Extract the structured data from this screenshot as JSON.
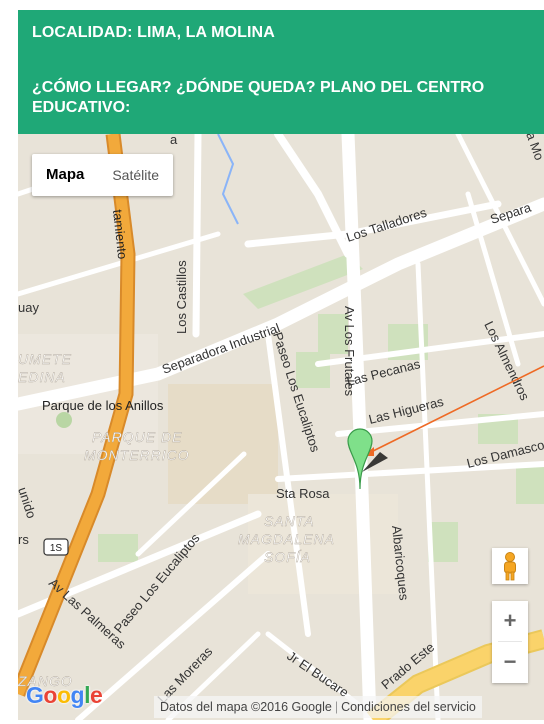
{
  "header": {
    "locality": "LOCALIDAD: LIMA, LA MOLINA",
    "directions": "¿CÓMO LLEGAR? ¿DÓNDE QUEDA? PLANO DEL CENTRO EDUCATIVO:"
  },
  "map": {
    "map_type_options": [
      "Mapa",
      "Satélite"
    ],
    "selected_map_type": "Mapa",
    "zoom_in_label": "+",
    "zoom_out_label": "−",
    "logo": {
      "letters": [
        "G",
        "o",
        "o",
        "g",
        "l",
        "e"
      ],
      "colors": [
        "#4285f4",
        "#ea4335",
        "#fbbc05",
        "#4285f4",
        "#34a853",
        "#ea4335"
      ]
    },
    "attribution": "Datos del mapa ©2016 Google",
    "terms": "Condiciones del servicio",
    "labels": {
      "tamiento": "tamiento",
      "los_talladores": "Los Talladores",
      "separa": "Separa",
      "los_castillos": "Los Castillos",
      "separadora_industrial": "Separadora Industrial",
      "av_los_frutales": "Av Los Frutales",
      "uay": "uay",
      "umete": "UMETE",
      "edina": "EDINA",
      "parque_anillos": "Parque de los Anillos",
      "parque_de": "PARQUE DE",
      "monterrico": "MONTERRICO",
      "paseo_eucaliptos_1": "Paseo Los Eucaliptos",
      "paseo_eucaliptos_2": "Paseo Los Eucaliptos",
      "las_pecanas": "Las Pecanas",
      "las_higueras": "Las Higueras",
      "los_almendros": "Los Almendros",
      "los_damasco": "Los Damasco",
      "sta_rosa": "Sta Rosa",
      "santa": "SANTA",
      "magdalena": "MAGDALENA",
      "sofia": "SOFÍA",
      "albaricoques": "Albaricoques",
      "av_las_palmeras": "Av Las Palmeras",
      "las_moreras": "Las Moreras",
      "jr_el_bucare": "Jr El Bucare",
      "prado_este": "Prado Este",
      "route_1s": "1S",
      "unido": "unido",
      "zango": "ZANGO",
      "rs": "rs",
      "top_small": "a",
      "top_right": "a Mo"
    }
  }
}
